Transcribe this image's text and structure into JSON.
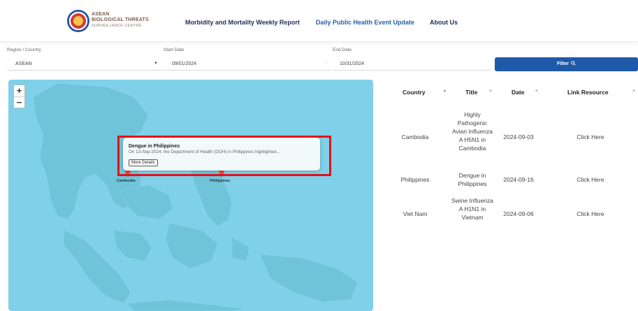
{
  "header": {
    "logo_line1": "ASEAN",
    "logo_line2": "BIOLOGICAL THREATS",
    "logo_line3": "SURVEILLANCE CENTRE",
    "nav": [
      {
        "label": "Morbidity and Mortality Weekly Report"
      },
      {
        "label": "Daily Public Health Event Update"
      },
      {
        "label": "About Us"
      }
    ]
  },
  "filters": {
    "region_label": "Region / Country",
    "region_value": "ASEAN",
    "start_label": "Start Date",
    "start_value": "09/01/2024",
    "end_label": "End Date",
    "end_value": "10/31/2024",
    "filter_button": "Filter"
  },
  "map": {
    "zoom_in": "+",
    "zoom_out": "−",
    "popup": {
      "title": "Dengue in Philippines",
      "text": "On 13-Sep-2024, the Department of Health (DOH) in Philippines highlighted...",
      "button": "More Details"
    },
    "markers": [
      {
        "label": "Cambodia"
      },
      {
        "label": "Philippines"
      }
    ]
  },
  "table": {
    "headers": [
      "Country",
      "Title",
      "Date",
      "Link Resource"
    ],
    "rows": [
      {
        "country": "Cambodia",
        "title": "Highly Pathogenic Avian Influenza A H5N1 in Cambodia",
        "date": "2024-09-03",
        "link": "Click Here"
      },
      {
        "country": "Philippines",
        "title": "Dengue in Philippines",
        "date": "2024-09-16",
        "link": "Click Here"
      },
      {
        "country": "Viet Nam",
        "title": "Swine Influenza A H1N1 in Vietnam",
        "date": "2024-09-06",
        "link": "Click Here"
      }
    ]
  },
  "colors": {
    "primary": "#1e5aa8",
    "map_water": "#7fd0e8",
    "map_land": "#6fc4d9",
    "marker": "#e74c3c",
    "highlight": "#e3101b"
  }
}
